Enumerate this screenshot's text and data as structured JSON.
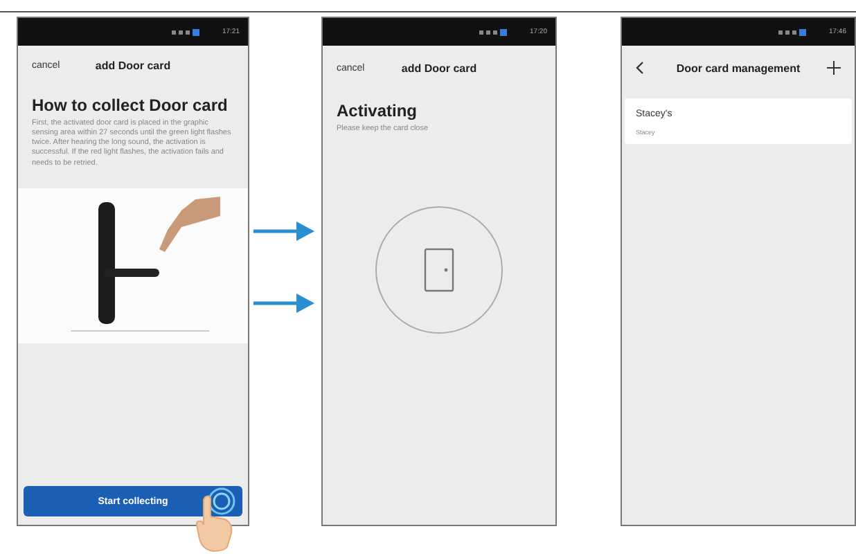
{
  "screens": [
    {
      "kind": "instructions",
      "status_time": "17:21",
      "cancel": "cancel",
      "title": "add Door card",
      "heading": "How to collect Door card",
      "description": "First, the activated door card is placed in the graphic sensing area within 27 seconds until the green light flashes twice. After hearing the long sound, the activation is successful. If the red light flashes, the activation fails and needs to be retried.",
      "button": "Start collecting"
    },
    {
      "kind": "activating",
      "status_time": "17:20",
      "cancel": "cancel",
      "title": "add Door card",
      "heading": "Activating",
      "description": "Please keep the card close"
    },
    {
      "kind": "list",
      "status_time": "17:46",
      "title": "Door card management",
      "cards": [
        {
          "name": "Stacey's",
          "owner": "Stacey"
        }
      ]
    }
  ]
}
